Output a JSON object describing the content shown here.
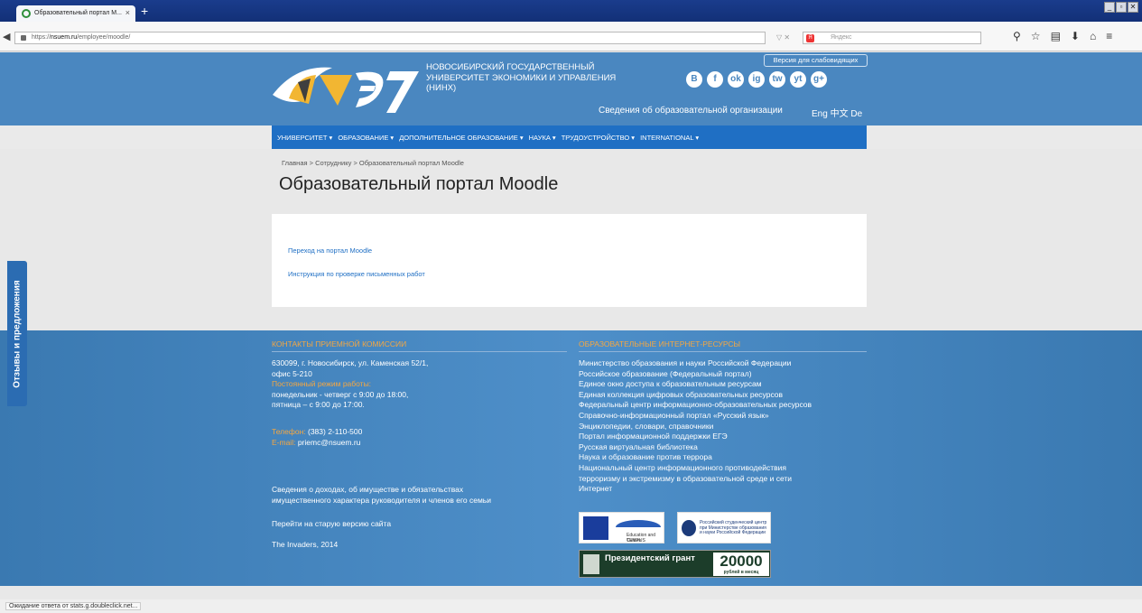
{
  "browser": {
    "tab_title": "Образовательный портал M...",
    "tab_close": "×",
    "new_tab": "+",
    "url_prefix": "https://",
    "url_domain": "nsuem.ru",
    "url_path": "/employee/moodle/",
    "url_controls": "▽ ✕",
    "search_engine": "Я",
    "search_placeholder": "Яндекс",
    "window_controls": [
      "_",
      "▫",
      "✕"
    ]
  },
  "header": {
    "university_name": [
      "НОВОСИБИРСКИЙ ГОСУДАРСТВЕННЫЙ",
      "УНИВЕРСИТЕТ ЭКОНОМИКИ И УПРАВЛЕНИЯ",
      "(НИНХ)"
    ],
    "vision_button": "Версия для слабовидящих",
    "social": [
      "В",
      "f",
      "ok",
      "ig",
      "tw",
      "yt",
      "g+"
    ],
    "org_info_link": "Сведения об образовательной организации",
    "languages": "Eng 中文 De"
  },
  "menu": [
    "УНИВЕРСИТЕТ ▾",
    "ОБРАЗОВАНИЕ ▾",
    "ДОПОЛНИТЕЛЬНОЕ ОБРАЗОВАНИЕ ▾",
    "НАУКА ▾",
    "ТРУДОУСТРОЙСТВО ▾",
    "INTERNATIONAL ▾"
  ],
  "breadcrumb": "Главная > Сотруднику > Образовательный портал Moodle",
  "page_title": "Образовательный портал Moodle",
  "links": {
    "moodle": "Переход на портал Moodle",
    "instructions": "Инструкция по проверке письменных работ"
  },
  "footer": {
    "contacts_heading": "КОНТАКТЫ ПРИЕМНОЙ КОМИССИИ",
    "address_1": "630099, г. Новосибирск, ул. Каменская 52/1,",
    "address_2": "офис 5-210",
    "schedule_label": "Постоянный режим работы:",
    "schedule_1": "понедельник - четверг с 9:00 до 18:00,",
    "schedule_2": "пятница – с 9:00 до 17:00.",
    "phone_label": "Телефон:",
    "phone": "(383) 2-110-500",
    "email_label": "E-mail:",
    "email": "priemc@nsuem.ru",
    "income_1": "Сведения о доходах, об имуществе и обязательствах",
    "income_2": "имущественного характера руководителя и членов его семьи",
    "old_version": "Перейти на старую версию сайта",
    "copyright": "The Invaders, 2014",
    "resources_heading": "ОБРАЗОВАТЕЛЬНЫЕ ИНТЕРНЕТ-РЕСУРСЫ",
    "resources": [
      "Министерство образования и науки Российской Федерации",
      "Российское образование (Федеральный портал)",
      "Единое окно доступа к образовательным ресурсам",
      "Единая коллекция цифровых образовательных ресурсов",
      "Федеральный центр информационно-образовательных ресурсов",
      "Справочно-информационный портал «Русский язык»",
      "Энциклопедии, словари, справочники",
      "Портал информационной поддержки ЕГЭ",
      "Русская виртуальная библиотека",
      "Наука и образование против террора",
      "Национальный центр информационного противодействия",
      "терроризму и экстремизму в образовательной среде и сети",
      "Интернет"
    ],
    "tempus_label": "Education and Culture",
    "tempus_sub": "TEMPUS",
    "rsc_label": "Российский студенческий центр при Министерстве образования и науки Российской Федерации",
    "grant_title": "Президентский грант",
    "grant_number": "20000",
    "grant_sub": "рублей в месяц"
  },
  "side_tab": "Отзывы и предложения",
  "status": "Ожидание ответа от stats.g.doubleclick.net..."
}
